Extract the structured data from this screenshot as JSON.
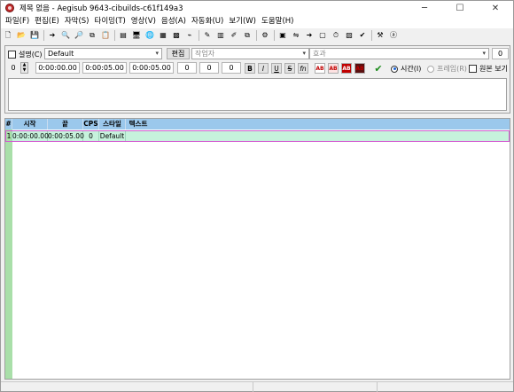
{
  "window": {
    "title": "제목 없음 - Aegisub 9643-cibuilds-c61f149a3",
    "minimize": "─",
    "maximize": "☐",
    "close": "✕"
  },
  "menu": [
    "파일(F)",
    "편집(E)",
    "자막(S)",
    "타이밍(T)",
    "영상(V)",
    "음성(A)",
    "자동화(U)",
    "보기(W)",
    "도움말(H)"
  ],
  "toolbar_groups": [
    [
      {
        "icon": "new-file-icon",
        "glyph": "🗋"
      },
      {
        "icon": "open-folder-icon",
        "glyph": "📂"
      },
      {
        "icon": "save-icon",
        "glyph": "💾"
      }
    ],
    [
      {
        "icon": "jump-icon",
        "glyph": "➔"
      },
      {
        "icon": "find-icon",
        "glyph": "🔍"
      },
      {
        "icon": "find-replace-icon",
        "glyph": "🔎"
      },
      {
        "icon": "copy-icon",
        "glyph": "⧉"
      },
      {
        "icon": "paste-icon",
        "glyph": "📋"
      }
    ],
    [
      {
        "icon": "styles-manager-icon",
        "glyph": "▤"
      },
      {
        "icon": "properties-icon",
        "glyph": "🖥"
      },
      {
        "icon": "attachments-icon",
        "glyph": "🌐"
      },
      {
        "icon": "fonts-collector-icon",
        "glyph": "▦"
      },
      {
        "icon": "resample-icon",
        "glyph": "▩"
      },
      {
        "icon": "timing-icon",
        "glyph": "⌁"
      }
    ],
    [
      {
        "icon": "spellcheck-icon",
        "glyph": "✎"
      },
      {
        "icon": "translation-icon",
        "glyph": "▥"
      },
      {
        "icon": "kanji-timer-icon",
        "glyph": "✐"
      },
      {
        "icon": "timing-processor-icon",
        "glyph": "⧉"
      }
    ],
    [
      {
        "icon": "automation-icon",
        "glyph": "⚙"
      }
    ],
    [
      {
        "icon": "video-details-icon",
        "glyph": "▣"
      },
      {
        "icon": "zoom-icon",
        "glyph": "⇋"
      },
      {
        "icon": "shift-times-icon",
        "glyph": "➜"
      },
      {
        "icon": "snap-icon",
        "glyph": "▢"
      },
      {
        "icon": "clock-icon",
        "glyph": "⏱"
      },
      {
        "icon": "layout-icon",
        "glyph": "▧"
      },
      {
        "icon": "options-check-icon",
        "glyph": "✔"
      }
    ],
    [
      {
        "icon": "tools-icon",
        "glyph": "⚒"
      },
      {
        "icon": "ai-icon",
        "glyph": "ⓐ"
      }
    ]
  ],
  "edit": {
    "comment_label": "설명(C)",
    "style_value": "Default",
    "edit_button": "편집",
    "actor_placeholder": "작업자",
    "effect_placeholder": "효과",
    "layer_right": "0",
    "layer_value": "0",
    "start_time": "0:00:00.00",
    "end_time": "0:00:05.00",
    "duration": "0:00:05.00",
    "margin_l": "0",
    "margin_r": "0",
    "margin_v": "0",
    "bold": "B",
    "italic": "I",
    "underline": "U",
    "strikeout": "S",
    "font": "fn",
    "color1": "AB",
    "color2": "AB",
    "color3": "AB",
    "color4": "AB",
    "commit": "✔",
    "time_mode": "시간(I)",
    "frame_mode": "프레임(R)",
    "show_original": "원본 보기"
  },
  "grid": {
    "headers": [
      "#",
      "시작",
      "끝",
      "CPS",
      "스타일",
      "텍스트"
    ],
    "rows": [
      {
        "num": "1",
        "start": "0:00:00.00",
        "end": "0:00:05.00",
        "cps": "0",
        "style": "Default",
        "text": ""
      }
    ]
  },
  "colors": {
    "grid_header": "#9bc8ec",
    "row_selected": "#c6f2dc",
    "row_border": "#d35ad1",
    "gutter": "#a9dfa9"
  }
}
